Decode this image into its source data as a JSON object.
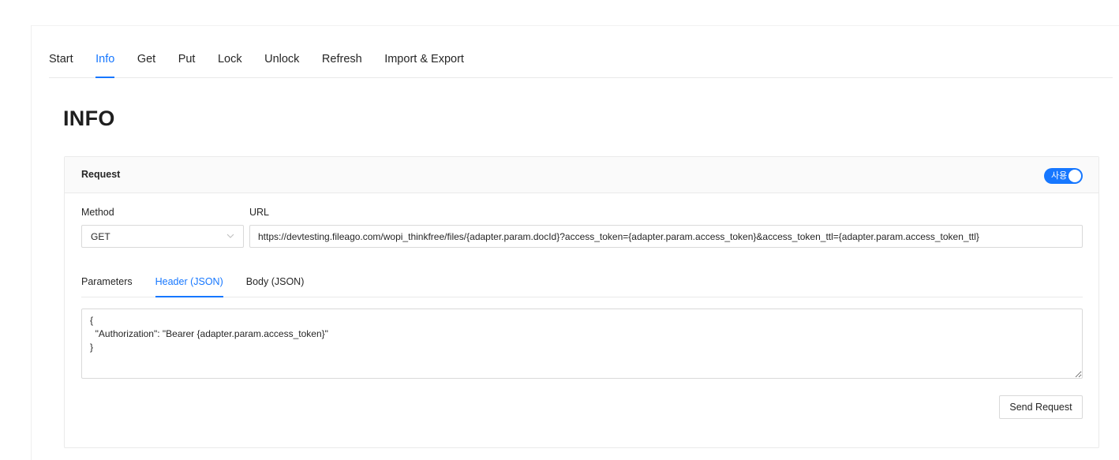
{
  "top_tabs": [
    {
      "label": "Start"
    },
    {
      "label": "Info"
    },
    {
      "label": "Get"
    },
    {
      "label": "Put"
    },
    {
      "label": "Lock"
    },
    {
      "label": "Unlock"
    },
    {
      "label": "Refresh"
    },
    {
      "label": "Import & Export"
    }
  ],
  "active_top_tab": "Info",
  "page_title": "INFO",
  "request": {
    "title": "Request",
    "toggle": {
      "label": "사용",
      "state": "on"
    },
    "method_label": "Method",
    "method_value": "GET",
    "url_label": "URL",
    "url_value": "https://devtesting.fileago.com/wopi_thinkfree/files/{adapter.param.docId}?access_token={adapter.param.access_token}&access_token_ttl={adapter.param.access_token_ttl}",
    "sub_tabs": [
      {
        "label": "Parameters"
      },
      {
        "label": "Header (JSON)"
      },
      {
        "label": "Body (JSON)"
      }
    ],
    "active_sub_tab": "Header (JSON)",
    "header_json": "{\n  \"Authorization\": \"Bearer {adapter.param.access_token}\"\n}",
    "send_button_label": "Send Request"
  },
  "icons": {
    "method_select": "chevron-down-icon"
  },
  "colors": {
    "accent": "#1677ff",
    "border": "#d9d9d9",
    "card_header_bg": "#fafafa"
  }
}
